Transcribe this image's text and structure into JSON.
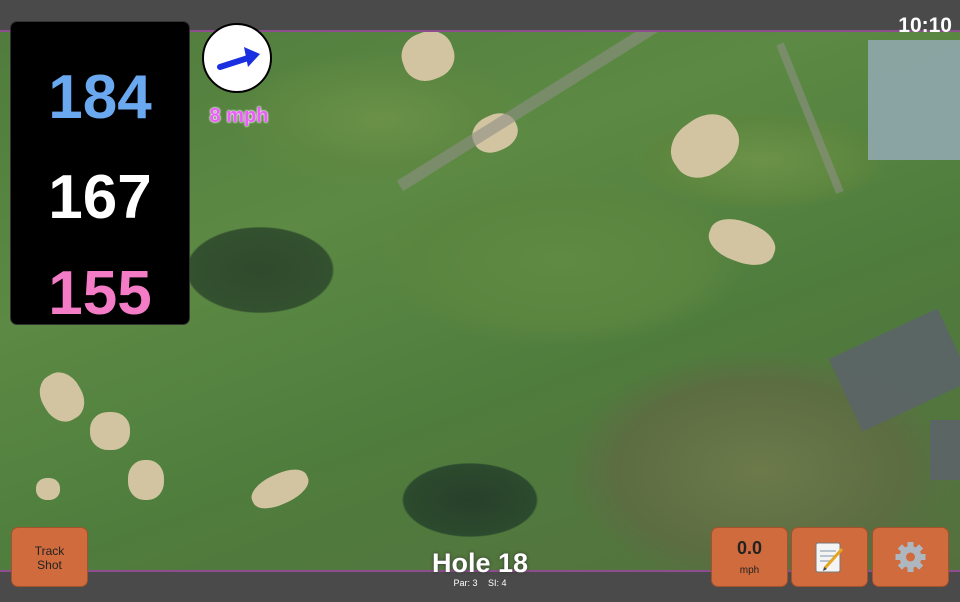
{
  "status": {
    "time": "10:10"
  },
  "distances": {
    "back": "184",
    "middle": "167",
    "front": "155"
  },
  "wind": {
    "speed": "8 mph",
    "icon": "wind-arrow-icon"
  },
  "hole": {
    "title": "Hole 18",
    "par": "Par: 3",
    "si": "SI: 4"
  },
  "buttons": {
    "track_shot": {
      "line1": "Track",
      "line2": "Shot"
    },
    "speed": {
      "value": "0.0",
      "unit": "mph"
    },
    "notes": {
      "icon": "notepad-icon"
    },
    "settings": {
      "icon": "gear-icon"
    }
  },
  "colors": {
    "accent": "#d06b3d",
    "back": "#6aa8ef",
    "middle": "#ffffff",
    "front": "#f47cc7",
    "wind": "#f05bff"
  }
}
